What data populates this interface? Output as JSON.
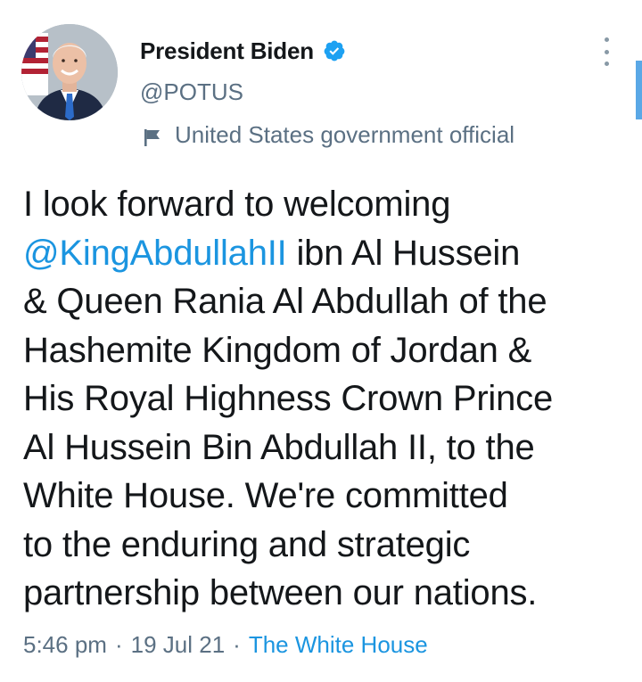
{
  "author": {
    "display_name": "President Biden",
    "handle": "@POTUS",
    "verified": true,
    "account_label": "United States government official",
    "avatar_icon": "profile-photo"
  },
  "tweet": {
    "text_before": "I look forward to welcoming\n",
    "mention": "@KingAbdullahII",
    "text_after": " ibn Al Hussein\n& Queen Rania Al Abdullah of the\nHashemite Kingdom of Jordan &\nHis Royal Highness Crown Prince\nAl Hussein Bin Abdullah II, to the\nWhite House. We're committed\nto the enduring and strategic\npartnership between our nations.",
    "time": "5:46 pm",
    "date": "19 Jul 21",
    "separator": "·",
    "source": "The White House"
  },
  "colors": {
    "link": "#1b95e0",
    "secondary_text": "#5b7083",
    "verified_badge": "#1da1f2"
  },
  "icons": {
    "more": "more-vertical-icon",
    "verified": "verified-badge-icon",
    "label": "flag-icon"
  }
}
